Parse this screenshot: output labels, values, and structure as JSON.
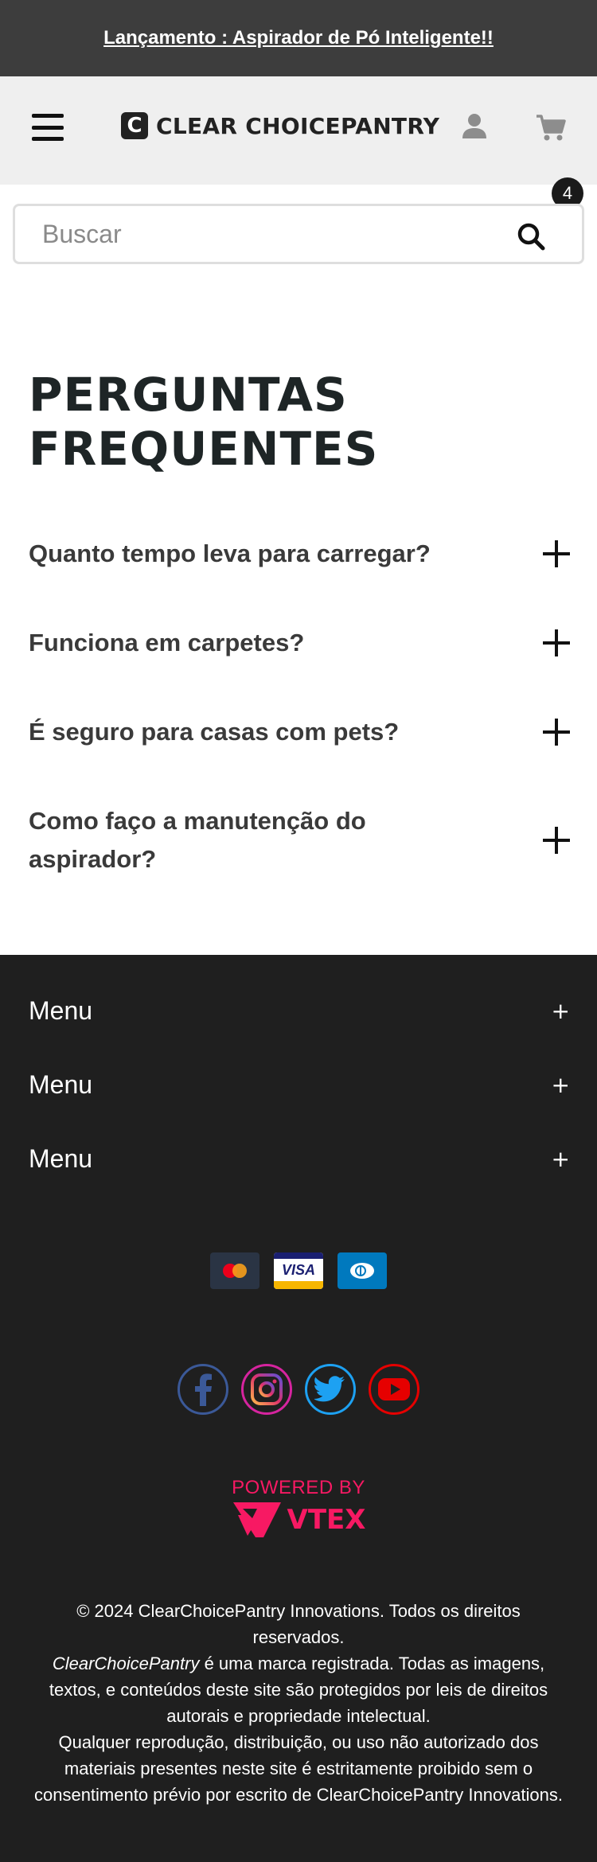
{
  "announcement": {
    "text": "Lançamento : Aspirador de Pó Inteligente!!"
  },
  "header": {
    "menu_icon": "hamburger-icon",
    "brand_initial": "C",
    "brand_name": "CLEAR CHOICEPANTRY",
    "user_icon": "user-icon",
    "cart_icon": "cart-icon",
    "cart_count": "4"
  },
  "search": {
    "placeholder": "Buscar",
    "icon": "search-icon"
  },
  "faq": {
    "title": "PERGUNTAS FREQUENTES",
    "questions": [
      {
        "text": "Quanto tempo leva para carregar?"
      },
      {
        "text": "Funciona em carpetes?"
      },
      {
        "text": "É seguro para casas com pets?"
      },
      {
        "text": "Como faço a manutenção do aspirador?"
      }
    ]
  },
  "footer": {
    "menus": [
      {
        "label": "Menu",
        "toggle": "+"
      },
      {
        "label": "Menu",
        "toggle": "+"
      },
      {
        "label": "Menu",
        "toggle": "+"
      }
    ],
    "payment_icons": [
      "mastercard-icon",
      "visa-icon",
      "diners-icon"
    ],
    "visa_text": "VISA",
    "social_icons": [
      "facebook-icon",
      "instagram-icon",
      "twitter-icon",
      "youtube-icon"
    ],
    "powered_by": "POWERED BY",
    "vtex": "VTEX",
    "legal": {
      "line1": "© 2024 ClearChoicePantry Innovations. Todos os direitos reservados.",
      "brand_italic": "ClearChoicePantry",
      "line2": " é uma marca registrada. Todas as imagens, textos, e conteúdos deste site são protegidos por leis de direitos autorais e propriedade intelectual.",
      "line3": "Qualquer reprodução, distribuição, ou uso não autorizado dos materiais presentes neste site é estritamente proibido sem o consentimento prévio por escrito de ClearChoicePantry Innovations."
    }
  },
  "colors": {
    "announcement_bg": "#3d3d3d",
    "header_bg": "#efefef",
    "footer_bg": "#1f1f1f",
    "vtex_pink": "#f71963",
    "facebook": "#3b5998",
    "twitter": "#1da1f2",
    "youtube": "#e60000"
  }
}
